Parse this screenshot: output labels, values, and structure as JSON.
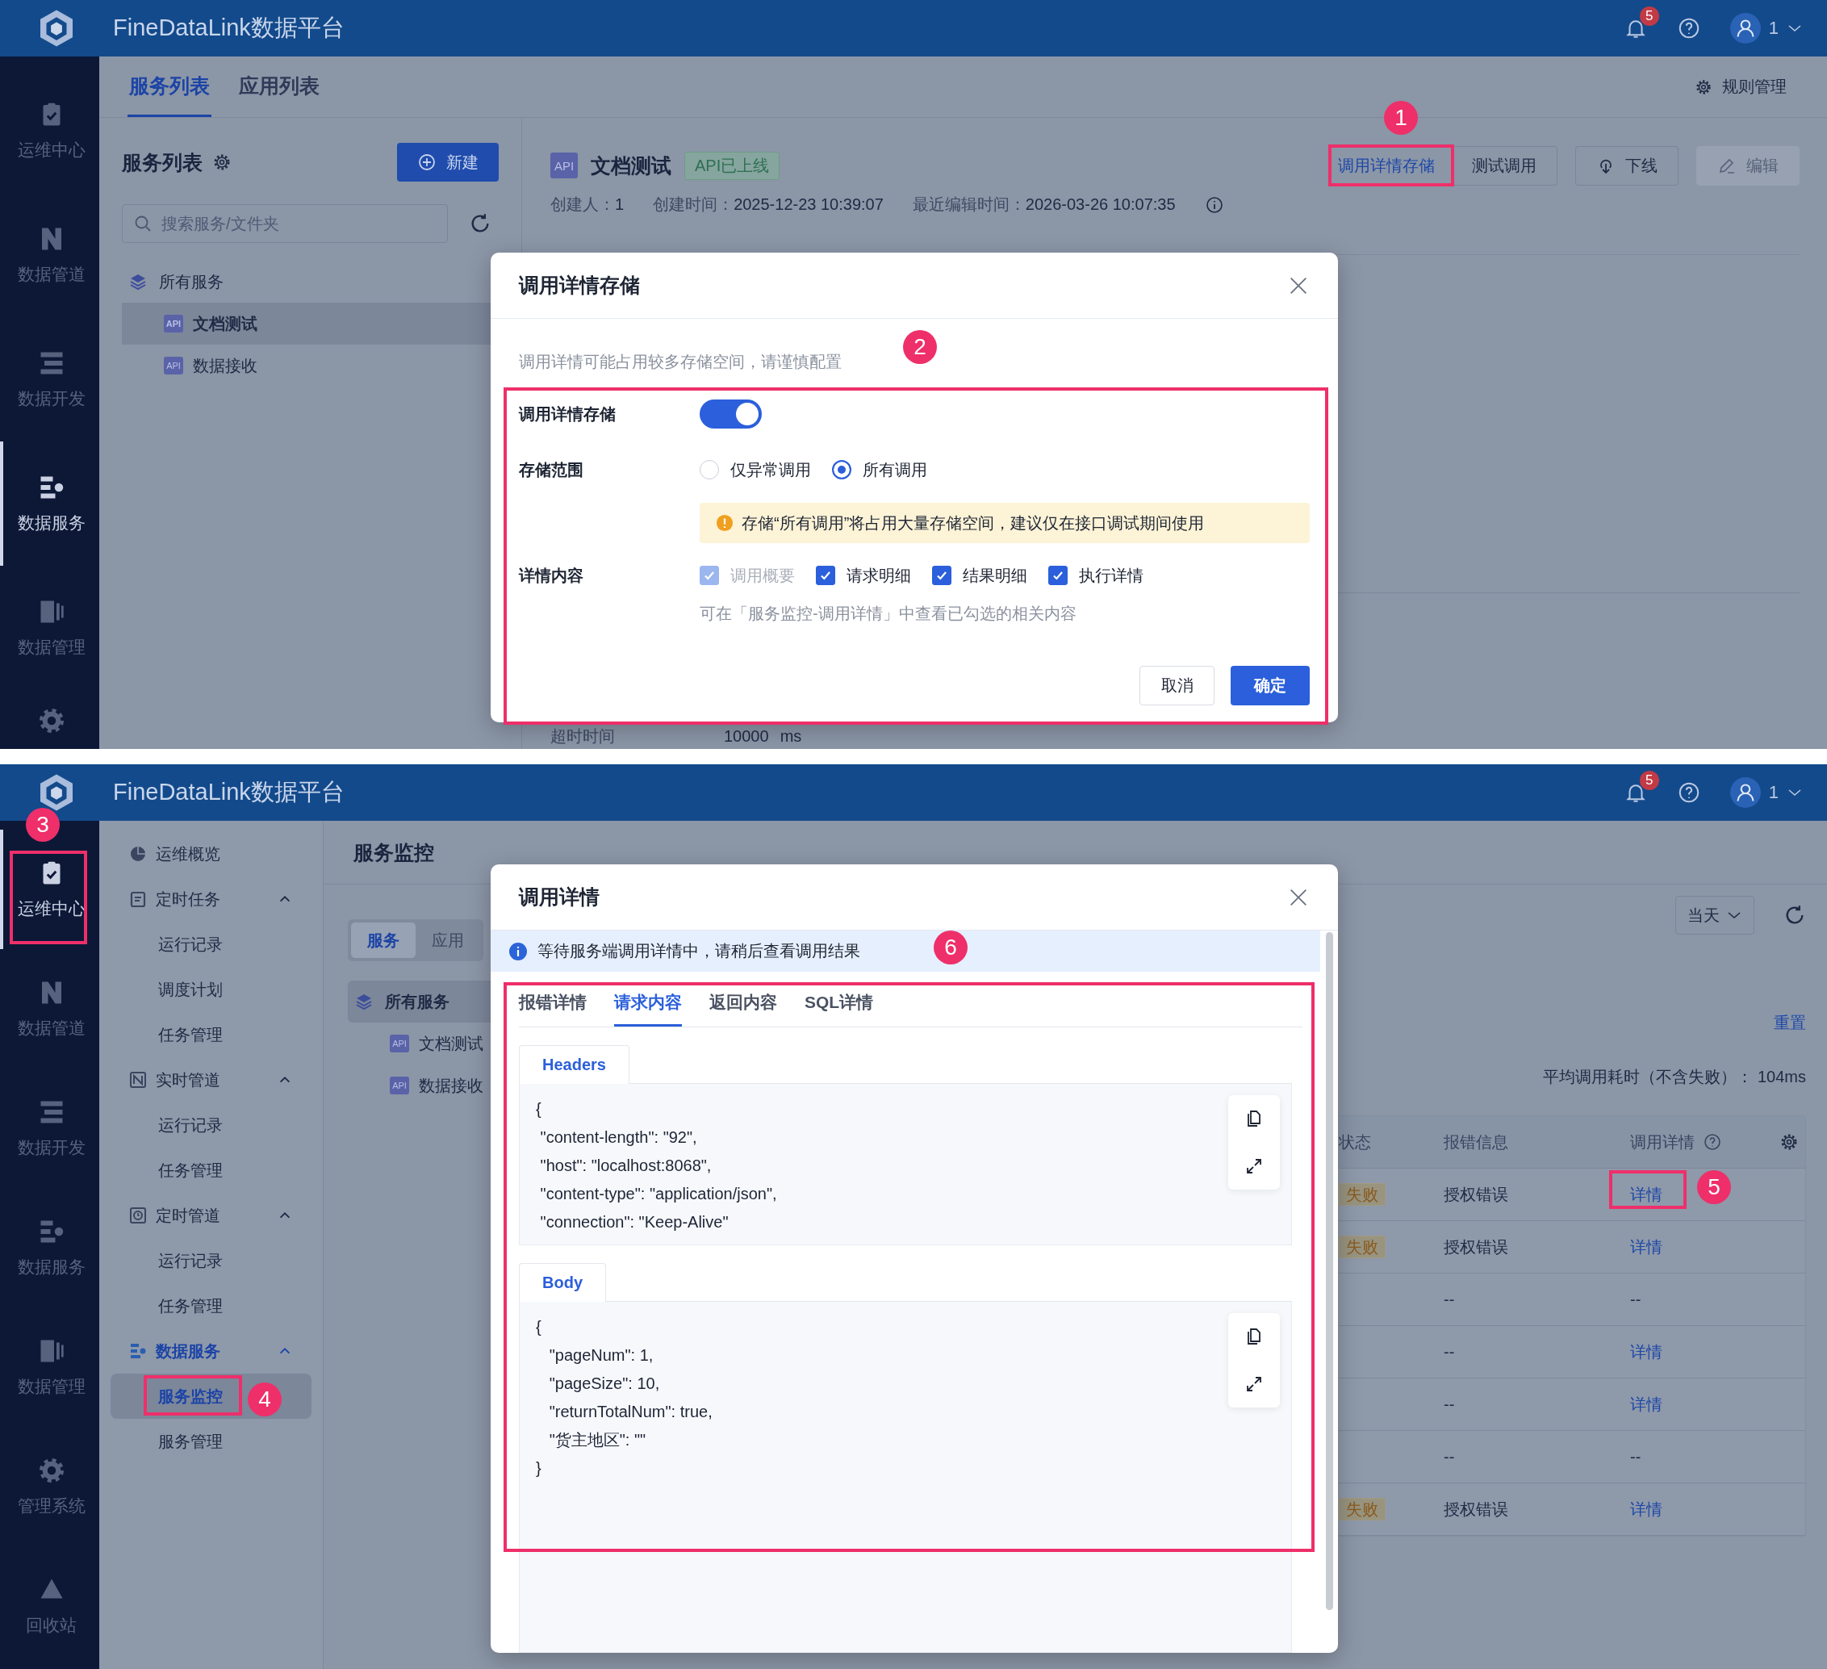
{
  "top_screen": {
    "header": {
      "title": "FineDataLink数据平台",
      "notification_count": "5",
      "user": "1"
    },
    "rail": [
      {
        "label": "运维中心",
        "kind": "ops",
        "selected": false
      },
      {
        "label": "数据管道",
        "kind": "pipeline",
        "selected": false
      },
      {
        "label": "数据开发",
        "kind": "develop",
        "selected": false
      },
      {
        "label": "数据服务",
        "kind": "service",
        "selected": true
      },
      {
        "label": "数据管理",
        "kind": "manage",
        "selected": false
      },
      {
        "kind": "system",
        "selected": false
      }
    ],
    "tabs": [
      {
        "label": "服务列表",
        "selected": true
      },
      {
        "label": "应用列表",
        "selected": false
      }
    ],
    "rules_link": "规则管理",
    "service_panel": {
      "title": "服务列表",
      "new_button": "新建",
      "search": {
        "placeholder": "搜索服务/文件夹"
      },
      "tree": [
        {
          "label": "所有服务",
          "selected": false,
          "children": [
            {
              "badge": "API",
              "label": "文档测试",
              "selected": true
            },
            {
              "badge": "API",
              "label": "数据接收",
              "selected": false
            }
          ]
        }
      ]
    },
    "detail": {
      "api_badge": "API",
      "name": "文档测试",
      "status_tag": "API已上线",
      "meta": [
        {
          "label": "创建人：",
          "value": "1"
        },
        {
          "label": "创建时间：",
          "value": "2025-12-23 10:39:07"
        },
        {
          "label": "最近编辑时间：",
          "value": "2026-03-26 10:07:35"
        }
      ],
      "actions": [
        {
          "label": "调用详情存储",
          "kind": "text",
          "disabled": false
        },
        {
          "label": "测试调用",
          "kind": "plain",
          "disabled": false
        },
        {
          "label": "下线",
          "kind": "offline",
          "disabled": false
        },
        {
          "label": "编辑",
          "kind": "edit",
          "disabled": true
        }
      ],
      "timeout": {
        "label": "超时时间",
        "value": "10000",
        "unit": "ms"
      }
    },
    "dialog": {
      "title": "调用详情存储",
      "hint": "调用详情可能占用较多存储空间，请谨慎配置",
      "storage_label": "调用详情存储",
      "storage_on": true,
      "scope_label": "存储范围",
      "scope_options": [
        {
          "label": "仅异常调用",
          "selected": false
        },
        {
          "label": "所有调用",
          "selected": true
        }
      ],
      "warning": "存储“所有调用”将占用大量存储空间，建议仅在接口调试期间使用",
      "content_label": "详情内容",
      "content_options": [
        {
          "label": "调用概要",
          "checked": true,
          "disabled": true
        },
        {
          "label": "请求明细",
          "checked": true,
          "disabled": false
        },
        {
          "label": "结果明细",
          "checked": true,
          "disabled": false
        },
        {
          "label": "执行详情",
          "checked": true,
          "disabled": false
        }
      ],
      "content_hint": "可在「服务监控-调用详情」中查看已勾选的相关内容",
      "cancel": "取消",
      "confirm": "确定"
    },
    "annotations": [
      {
        "number": "1"
      },
      {
        "number": "2"
      }
    ]
  },
  "bottom_screen": {
    "header": {
      "title": "FineDataLink数据平台",
      "notification_count": "5",
      "user": "1"
    },
    "rail": [
      {
        "label": "运维中心",
        "kind": "ops",
        "selected": true
      },
      {
        "label": "数据管道",
        "kind": "pipeline",
        "selected": false
      },
      {
        "label": "数据开发",
        "kind": "develop",
        "selected": false
      },
      {
        "label": "数据服务",
        "kind": "service",
        "selected": false
      },
      {
        "label": "数据管理",
        "kind": "manage",
        "selected": false
      },
      {
        "label": "管理系统",
        "kind": "system",
        "selected": false
      },
      {
        "label": "回收站",
        "kind": "recycle",
        "selected": false
      }
    ],
    "nav": [
      {
        "label": "运维概览",
        "kind": "overview",
        "selected": false
      },
      {
        "label": "定时任务",
        "kind": "task",
        "selected": false,
        "expanded": true,
        "children": [
          {
            "label": "运行记录",
            "selected": false
          },
          {
            "label": "调度计划",
            "selected": false
          },
          {
            "label": "任务管理",
            "selected": false
          }
        ]
      },
      {
        "label": "实时管道",
        "kind": "realtime",
        "selected": false,
        "expanded": true,
        "children": [
          {
            "label": "运行记录",
            "selected": false
          },
          {
            "label": "任务管理",
            "selected": false
          }
        ]
      },
      {
        "label": "定时管道",
        "kind": "scheduled",
        "selected": false,
        "expanded": true,
        "children": [
          {
            "label": "运行记录",
            "selected": false
          },
          {
            "label": "任务管理",
            "selected": false
          }
        ]
      },
      {
        "label": "数据服务",
        "kind": "service",
        "selected": true,
        "expanded": true,
        "children": [
          {
            "label": "服务监控",
            "selected": true
          },
          {
            "label": "服务管理",
            "selected": false
          }
        ]
      }
    ],
    "page_title": "服务监控",
    "segments": [
      {
        "label": "服务",
        "selected": true
      },
      {
        "label": "应用",
        "selected": false
      }
    ],
    "tree": [
      {
        "label": "所有服务",
        "selected": true,
        "children": [
          {
            "badge": "API",
            "label": "文档测试",
            "selected": false
          },
          {
            "badge": "API",
            "label": "数据接收",
            "selected": false
          }
        ]
      }
    ],
    "date_filter": "当天",
    "reset_link": "重置",
    "average": "平均调用耗时（不含失败）： 104ms",
    "table": {
      "columns": [
        "状态",
        "报错信息",
        "调用详情"
      ],
      "rows": [
        {
          "status": "失败",
          "error": "授权错误",
          "detail": "详情",
          "kind": "link"
        },
        {
          "status": "失败",
          "error": "授权错误",
          "detail": "详情",
          "kind": "link"
        },
        {
          "error": "--",
          "detail": "--",
          "kind": "text"
        },
        {
          "error": "--",
          "detail": "详情",
          "kind": "link"
        },
        {
          "error": "--",
          "detail": "详情",
          "kind": "link"
        },
        {
          "error": "--",
          "detail": "--",
          "kind": "text"
        },
        {
          "status": "失败",
          "error": "授权错误",
          "detail": "详情",
          "kind": "link"
        }
      ]
    },
    "dialog": {
      "title": "调用详情",
      "notice": "等待服务端调用详情中，请稍后查看调用结果",
      "tabs": [
        {
          "label": "报错详情",
          "selected": false
        },
        {
          "label": "请求内容",
          "selected": true
        },
        {
          "label": "返回内容",
          "selected": false
        },
        {
          "label": "SQL详情",
          "selected": false
        }
      ],
      "sections": [
        {
          "title": "Headers",
          "lines": [
            "{",
            " \"content-length\": \"92\",",
            " \"host\": \"localhost:8068\",",
            " \"content-type\": \"application/json\",",
            " \"connection\": \"Keep-Alive\""
          ]
        },
        {
          "title": "Body",
          "lines": [
            "{",
            "   \"pageNum\": 1,",
            "   \"pageSize\": 10,",
            "   \"returnTotalNum\": true,",
            "   \"货主地区\": \"\"",
            "}"
          ]
        }
      ]
    },
    "annotations": [
      {
        "number": "3"
      },
      {
        "number": "4"
      },
      {
        "number": "5"
      },
      {
        "number": "6"
      }
    ]
  }
}
